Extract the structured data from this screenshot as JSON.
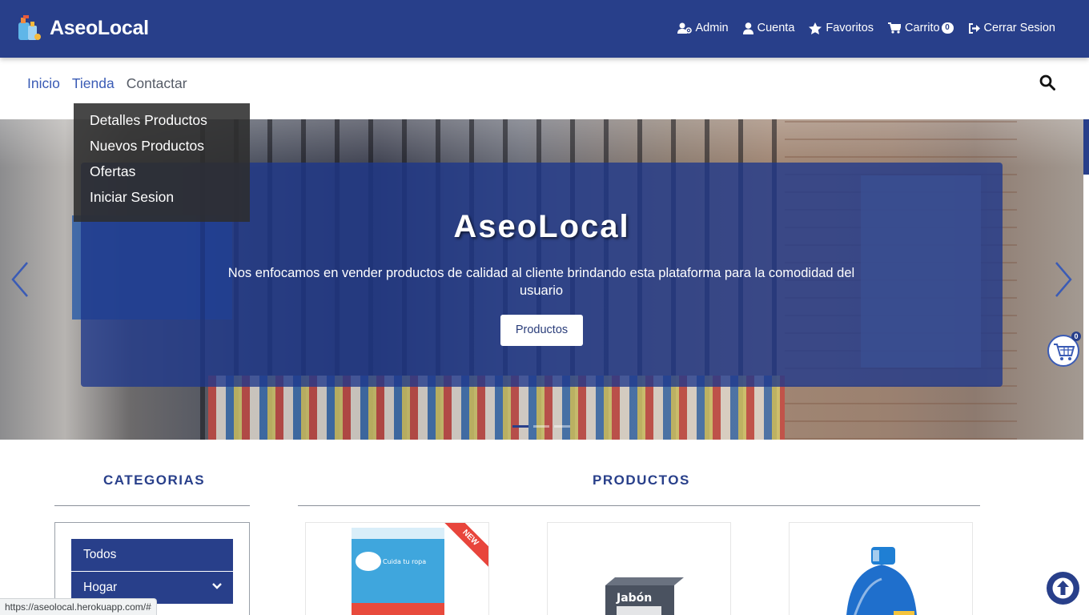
{
  "brand": {
    "title": "AseoLocal"
  },
  "topnav": {
    "admin": "Admin",
    "account": "Cuenta",
    "favorites": "Favoritos",
    "cart": "Carrito",
    "cart_count": "0",
    "logout": "Cerrar Sesion"
  },
  "subnav": {
    "items": [
      {
        "label": "Inicio"
      },
      {
        "label": "Tienda"
      },
      {
        "label": "Contactar"
      }
    ]
  },
  "dropdown": {
    "items": [
      {
        "label": "Detalles Productos"
      },
      {
        "label": "Nuevos Productos"
      },
      {
        "label": "Ofertas"
      },
      {
        "label": "Iniciar Sesion"
      }
    ]
  },
  "hero": {
    "title": "AseoLocal",
    "text": "Nos enfocamos en vender productos de calidad al cliente brindando esta plataforma para la comodidad del usuario",
    "button": "Productos"
  },
  "floating_cart": {
    "count": "0"
  },
  "sections": {
    "categories_title": "CATEGORIAS",
    "products_title": "PRODUCTOS"
  },
  "categories": [
    {
      "label": "Todos"
    },
    {
      "label": "Hogar"
    }
  ],
  "products": [
    {
      "badge": "NEW",
      "package_text": "Cuida tu ropa"
    },
    {
      "package_text": "Jabón"
    },
    {
      "package_text": ""
    }
  ],
  "status_url": "https://aseolocal.herokuapp.com/#",
  "colors": {
    "primary": "#283f8a",
    "accent": "#3a5bb5",
    "badge_red": "#e8453c"
  }
}
